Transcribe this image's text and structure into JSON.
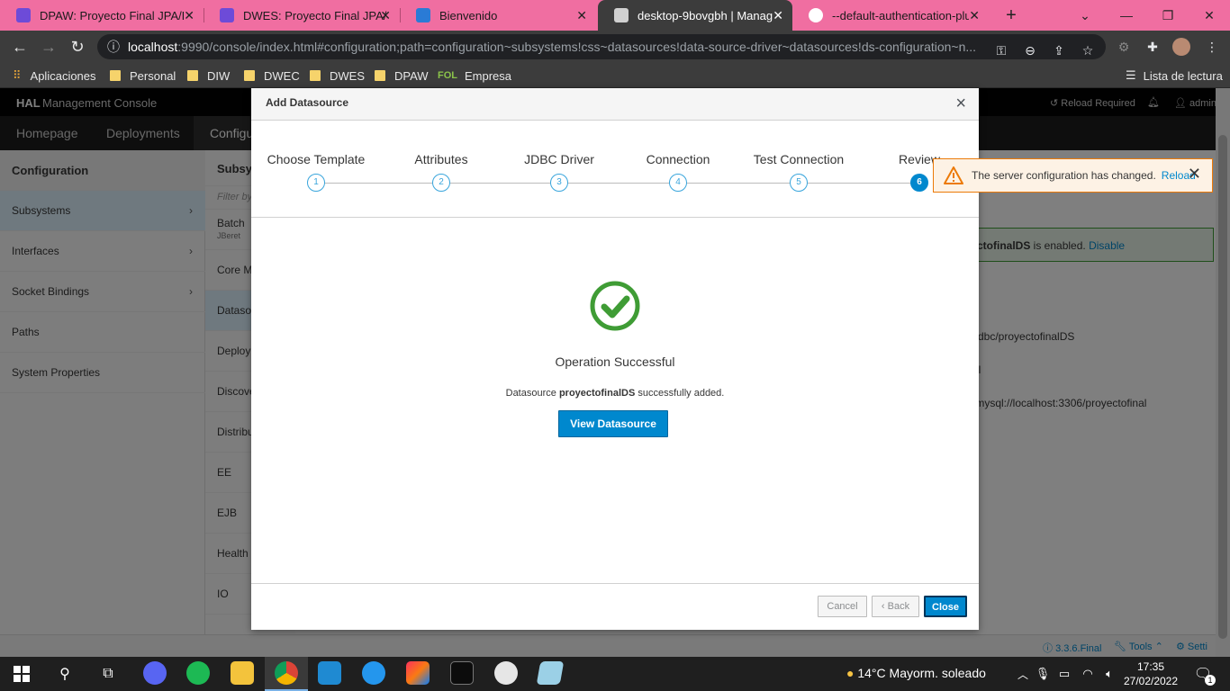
{
  "browser": {
    "tabs": [
      {
        "title": "DPAW: Proyecto Final JPA/Hi",
        "icon": "graduation-cap-icon",
        "icon_color": "#6d4bd8"
      },
      {
        "title": "DWES: Proyecto Final JPA/Hi",
        "icon": "graduation-cap-icon",
        "icon_color": "#6d4bd8"
      },
      {
        "title": "Bienvenido",
        "icon": "app-icon",
        "icon_color": "#2a7bd6"
      },
      {
        "title": "desktop-9bovgbh | Manage",
        "icon": "hal-icon",
        "icon_color": "#d0d0d0"
      },
      {
        "title": "--default-authentication-plu",
        "icon": "google-icon",
        "icon_color": "#ffffff"
      }
    ],
    "new_tab": "+",
    "url_host": "localhost",
    "url_rest": ":9990/console/index.html#configuration;path=configuration~subsystems!css~datasources!data-source-driver~datasources!ds-configuration~n...",
    "bookmarks": [
      {
        "label": "Aplicaciones",
        "icon": "apps-grid-icon"
      },
      {
        "label": "Personal",
        "icon": "folder-icon"
      },
      {
        "label": "DIW",
        "icon": "folder-icon"
      },
      {
        "label": "DWEC",
        "icon": "folder-icon"
      },
      {
        "label": "DWES",
        "icon": "folder-icon"
      },
      {
        "label": "DPAW",
        "icon": "folder-icon"
      },
      {
        "label": "Empresa",
        "icon": "fol-icon"
      }
    ],
    "reading_list": "Lista de lectura"
  },
  "hal": {
    "brand_bold": "HAL",
    "brand_rest": " Management Console",
    "reload_required": "Reload Required",
    "user": "admin",
    "nav": [
      "Homepage",
      "Deployments",
      "Configu"
    ],
    "sidebar_title": "Configuration",
    "sidebar_items": [
      "Subsystems",
      "Interfaces",
      "Socket Bindings",
      "Paths",
      "System Properties"
    ],
    "col2_title": "Subsys",
    "col2_filter": "Filter by",
    "col2_items": [
      {
        "label": "Batch",
        "sub": "JBeret"
      },
      {
        "label": "Core Ma",
        "sub": ""
      },
      {
        "label": "Dataso",
        "sub": ""
      },
      {
        "label": "Deploy",
        "sub": ""
      },
      {
        "label": "Discove",
        "sub": ""
      },
      {
        "label": "Distribu",
        "sub": ""
      },
      {
        "label": "EE",
        "sub": ""
      },
      {
        "label": "EJB",
        "sub": ""
      },
      {
        "label": "Health",
        "sub": ""
      },
      {
        "label": "IO",
        "sub": ""
      }
    ],
    "enabled_prefix": "ctofinalDS",
    "enabled_text": " is enabled. ",
    "disable_link": "Disable",
    "props": [
      "/jdbc/proyectofinalDS",
      "ql",
      ":mysql://localhost:3306/proyectofinal",
      "e"
    ],
    "footer_version": "3.3.6.Final",
    "footer_tools": "Tools",
    "footer_settings": "Setti"
  },
  "modal": {
    "title": "Add Datasource",
    "close_glyph": "×",
    "steps": [
      {
        "label": "Choose Template",
        "num": "1"
      },
      {
        "label": "Attributes",
        "num": "2"
      },
      {
        "label": "JDBC Driver",
        "num": "3"
      },
      {
        "label": "Connection",
        "num": "4"
      },
      {
        "label": "Test Connection",
        "num": "5"
      },
      {
        "label": "Review",
        "num": "6"
      }
    ],
    "success_title": "Operation Successful",
    "msg_prefix": "Datasource ",
    "msg_name": "proyectofinalDS",
    "msg_suffix": " successfully added.",
    "view_button": "View Datasource",
    "cancel": "Cancel",
    "back": "‹ Back",
    "close": "Close",
    "success_color": "#3f9c35"
  },
  "notification": {
    "text": "The server configuration has changed.",
    "link": "Reload",
    "close_glyph": "✕"
  },
  "taskbar": {
    "weather": "14°C  Mayorm. soleado",
    "time": "17:35",
    "date": "27/02/2022",
    "notif_count": "1"
  }
}
